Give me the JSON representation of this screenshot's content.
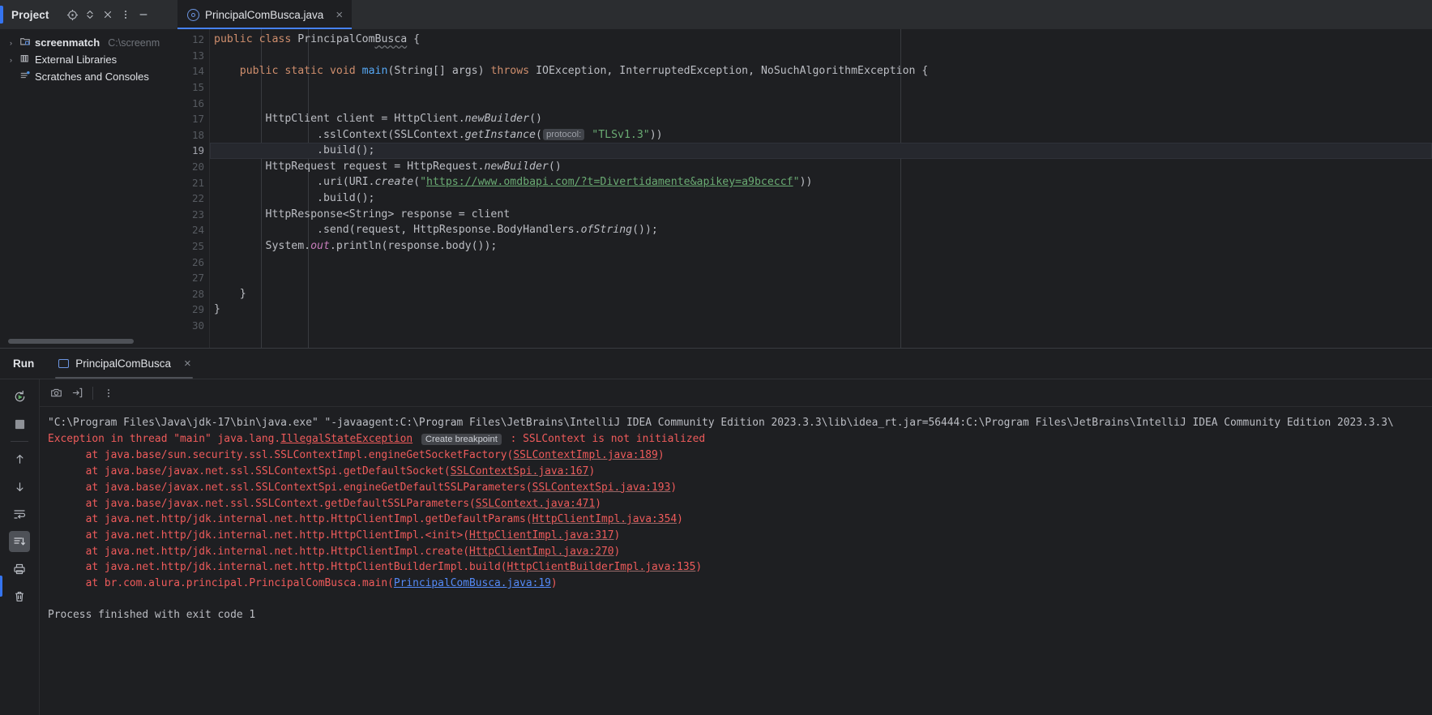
{
  "window": {
    "accent_color": "#3574f0",
    "bg": "#1e1f22",
    "panel_bg": "#2b2d30"
  },
  "project_panel": {
    "title": "Project",
    "toolbar_icons": [
      "locate-icon",
      "expand-collapse-icon",
      "close-icon",
      "more-options-icon",
      "minimize-icon"
    ],
    "tree": [
      {
        "label": "screenmatch",
        "sub": "C:\\screenm",
        "bold": true,
        "chevron": "›",
        "icon": "module-folder-icon"
      },
      {
        "label": "External Libraries",
        "sub": "",
        "bold": false,
        "chevron": "›",
        "icon": "library-icon"
      },
      {
        "label": "Scratches and Consoles",
        "sub": "",
        "bold": false,
        "chevron": "",
        "icon": "scratches-icon"
      }
    ]
  },
  "editor_tabs": [
    {
      "label": "PrincipalComBusca.java",
      "icon": "java-class-icon",
      "close": "×",
      "active": true
    }
  ],
  "editor": {
    "first_line": 12,
    "highlight_line": 19,
    "run_marker_lines": [
      12,
      14
    ],
    "lines": [
      {
        "n": 12,
        "html": "<span class=\"kw\">public</span> <span class=\"kw\">class</span> PrincipalCom<span class=\"squig\">Busca</span> {"
      },
      {
        "n": 13,
        "html": ""
      },
      {
        "n": 14,
        "html": "    <span class=\"kw\">public</span> <span class=\"kw\">static</span> <span class=\"kw\">void</span> <span class=\"meth\">main</span>(String[] args) <span class=\"kw\">throws</span> IOException, InterruptedException, NoSuchAlgorithmException {"
      },
      {
        "n": 15,
        "html": ""
      },
      {
        "n": 16,
        "html": ""
      },
      {
        "n": 17,
        "html": "        HttpClient client = HttpClient.<span class=\"ital\">newBuilder</span>()"
      },
      {
        "n": 18,
        "html": "                .sslContext(SSLContext.<span class=\"ital\">getInstance</span>(<span class=\"hintchip\">protocol:</span> <span class=\"str\">\"TLSv1.3\"</span>))"
      },
      {
        "n": 19,
        "html": "                .build();"
      },
      {
        "n": 20,
        "html": "        HttpRequest request = HttpRequest.<span class=\"ital\">newBuilder</span>()"
      },
      {
        "n": 21,
        "html": "                .uri(URI.<span class=\"ital\">create</span>(<span class=\"str\">\"</span><span class=\"linkstr\">https://www.omdbapi.com/?t=Divertidamente&amp;apikey=a9bceccf</span><span class=\"str\">\"</span>))"
      },
      {
        "n": 22,
        "html": "                .build();"
      },
      {
        "n": 23,
        "html": "        HttpResponse&lt;String&gt; response = client"
      },
      {
        "n": 24,
        "html": "                .send(request, HttpResponse.BodyHandlers.<span class=\"ital\">ofString</span>());"
      },
      {
        "n": 25,
        "html": "        System.<span class=\"field\">out</span>.println(response.body());"
      },
      {
        "n": 26,
        "html": ""
      },
      {
        "n": 27,
        "html": ""
      },
      {
        "n": 28,
        "html": "    }"
      },
      {
        "n": 29,
        "html": "}"
      },
      {
        "n": 30,
        "html": ""
      }
    ]
  },
  "run_panel": {
    "title": "Run",
    "tab": {
      "label": "PrincipalComBusca",
      "icon": "run-config-icon",
      "close": "×"
    },
    "side_toolbar_icons": [
      "rerun-icon",
      "stop-icon",
      "scroll-up-icon",
      "scroll-down-icon",
      "soft-wrap-icon",
      "scroll-to-end-icon",
      "print-icon",
      "trash-icon"
    ],
    "console_toolbar_icons": [
      "camera-icon",
      "export-icon",
      "more-options-icon"
    ],
    "console": [
      {
        "type": "plain",
        "html": "\"C:\\Program Files\\Java\\jdk-17\\bin\\java.exe\" \"-javaagent:C:\\Program Files\\JetBrains\\IntelliJ IDEA Community Edition 2023.3.3\\lib\\idea_rt.jar=56444:C:\\Program Files\\JetBrains\\IntelliJ IDEA Community Edition 2023.3.3\\"
      },
      {
        "type": "err",
        "html": "Exception in thread \"main\" java.lang.<span class=\"exc-link\">IllegalStateException</span> <span class=\"bp-chip\">Create breakpoint</span> : SSLContext is not initialized"
      },
      {
        "type": "err",
        "html": "\tat java.base/sun.security.ssl.SSLContextImpl.engineGetSocketFactory(<span class=\"olink\">SSLContextImpl.java:189</span>)"
      },
      {
        "type": "err",
        "html": "\tat java.base/javax.net.ssl.SSLContextSpi.getDefaultSocket(<span class=\"olink\">SSLContextSpi.java:167</span>)"
      },
      {
        "type": "err",
        "html": "\tat java.base/javax.net.ssl.SSLContextSpi.engineGetDefaultSSLParameters(<span class=\"olink\">SSLContextSpi.java:193</span>)"
      },
      {
        "type": "err",
        "html": "\tat java.base/javax.net.ssl.SSLContext.getDefaultSSLParameters(<span class=\"olink\">SSLContext.java:471</span>)"
      },
      {
        "type": "err",
        "html": "\tat java.net.http/jdk.internal.net.http.HttpClientImpl.getDefaultParams(<span class=\"olink\">HttpClientImpl.java:354</span>)"
      },
      {
        "type": "err",
        "html": "\tat java.net.http/jdk.internal.net.http.HttpClientImpl.&lt;init&gt;(<span class=\"olink\">HttpClientImpl.java:317</span>)"
      },
      {
        "type": "err",
        "html": "\tat java.net.http/jdk.internal.net.http.HttpClientImpl.create(<span class=\"olink\">HttpClientImpl.java:270</span>)"
      },
      {
        "type": "err",
        "html": "\tat java.net.http/jdk.internal.net.http.HttpClientBuilderImpl.build(<span class=\"olink\">HttpClientBuilderImpl.java:135</span>)"
      },
      {
        "type": "err",
        "html": "\tat br.com.alura.principal.PrincipalComBusca.main(<span class=\"olink-blue\">PrincipalComBusca.java:19</span>)"
      },
      {
        "type": "blank",
        "html": ""
      },
      {
        "type": "plain",
        "html": "Process finished with exit code 1"
      }
    ]
  }
}
